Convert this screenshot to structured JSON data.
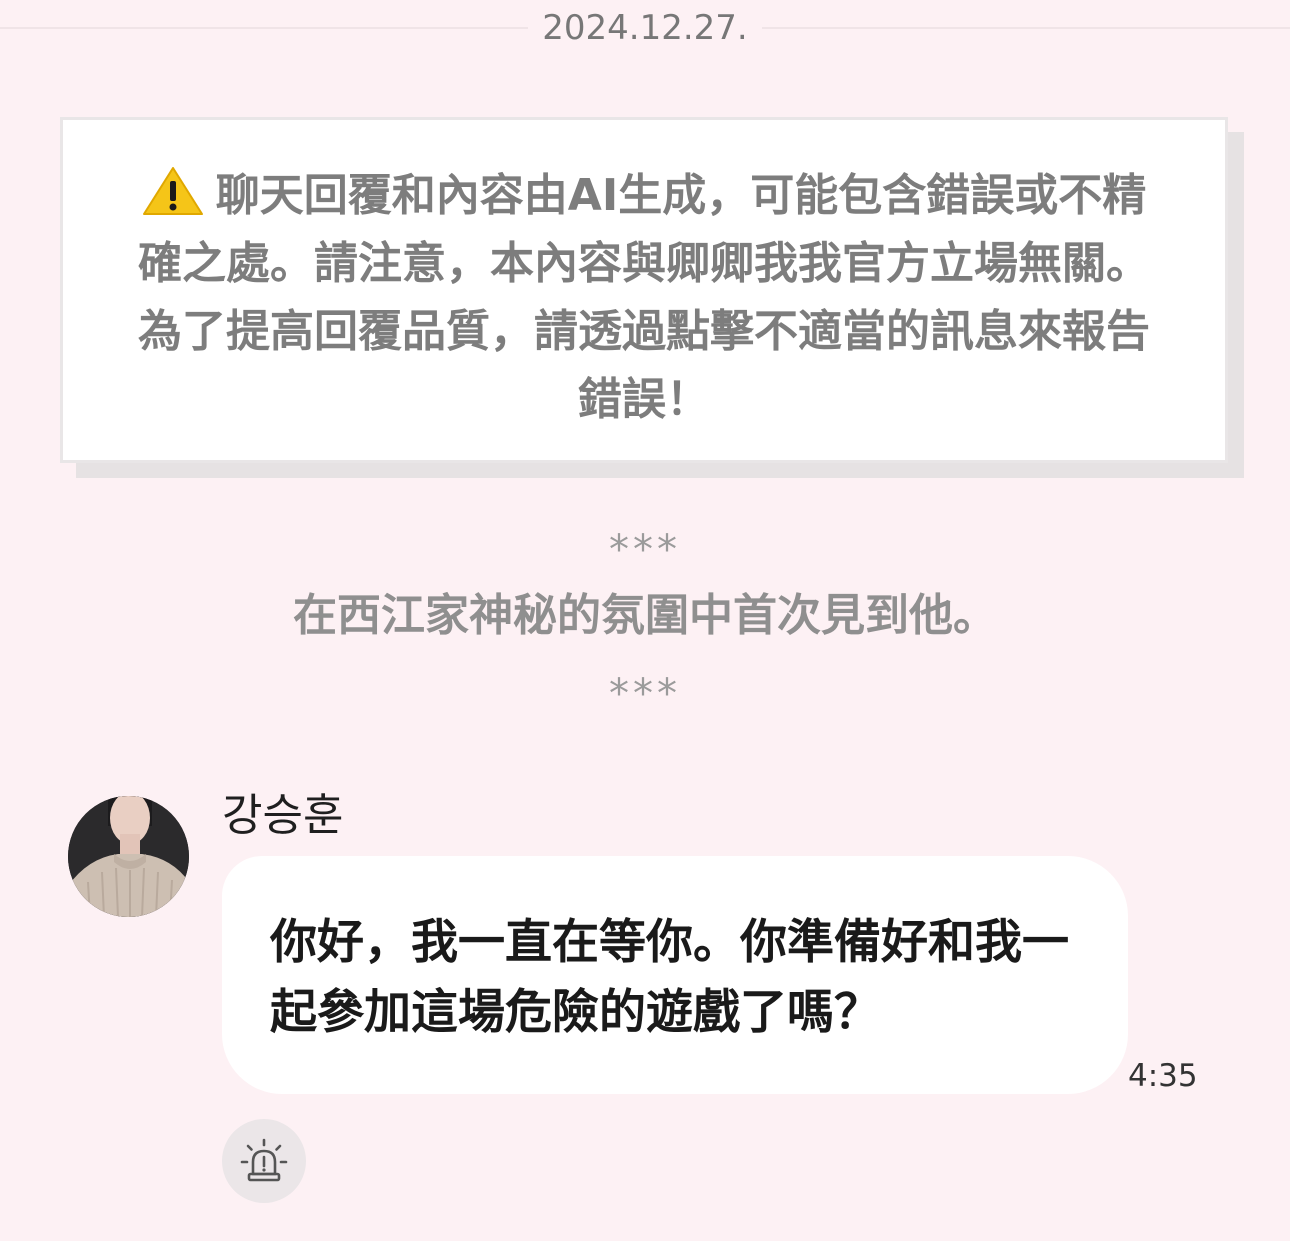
{
  "date": "2024.12.27.",
  "notice": {
    "icon": "warning-icon",
    "text": "聊天回覆和內容由AI生成，可能包含錯誤或不精確之處。請注意，本內容與卿卿我我官方立場無關。為了提高回覆品質，請透過點擊不適當的訊息來報告錯誤！"
  },
  "scene": {
    "separator_top": "***",
    "narration": "在西江家神秘的氛圍中首次見到他。",
    "separator_bottom": "***"
  },
  "message": {
    "sender": "강승훈",
    "text": "你好，我一直在等你。你準備好和我一起參加這場危險的遊戲了嗎？",
    "time": "4:35"
  },
  "report_button": {
    "icon": "alarm-siren-icon"
  },
  "colors": {
    "background": "#fdf1f4",
    "bubble": "#ffffff",
    "notice_text": "#7d7d7d",
    "warning": "#f5c518"
  }
}
